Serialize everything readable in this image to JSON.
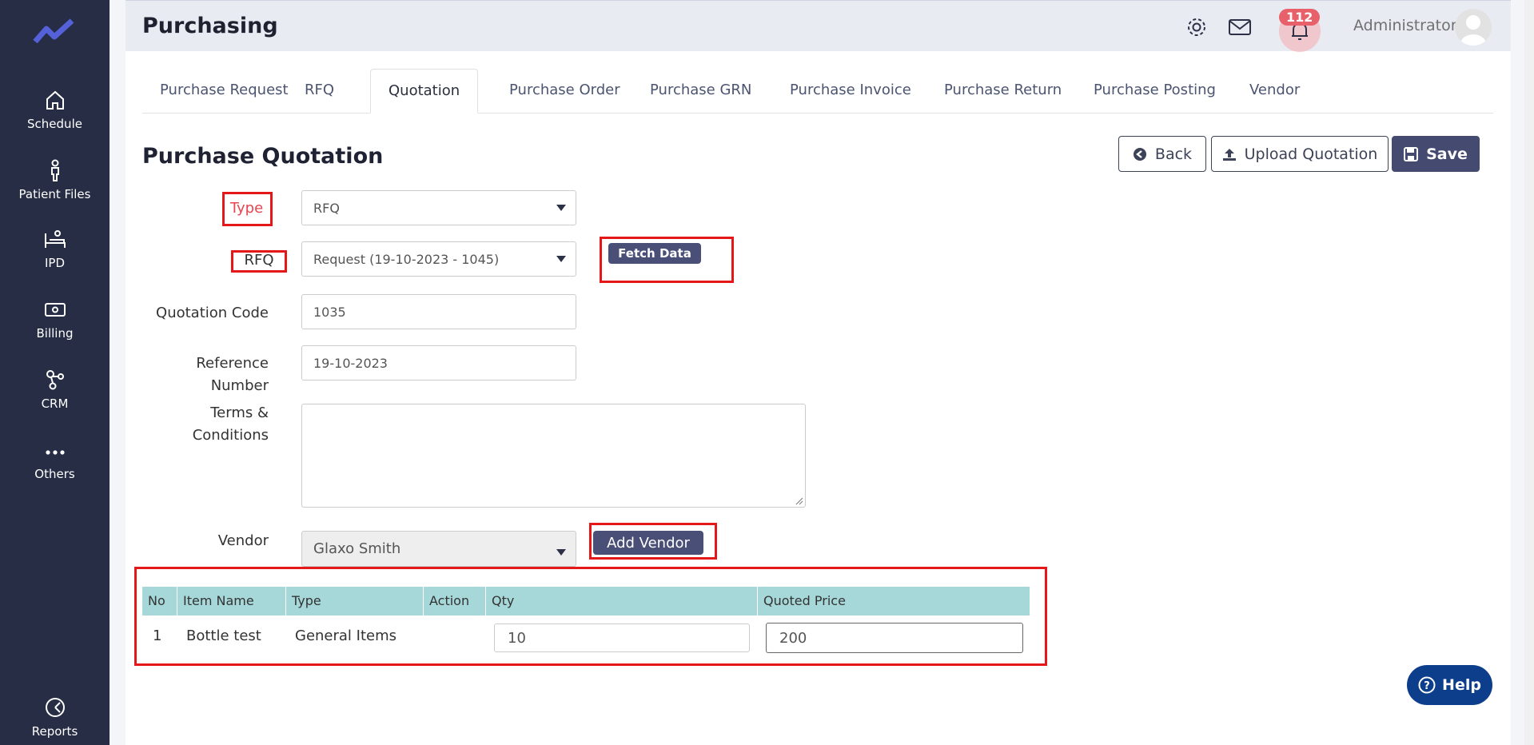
{
  "sidebar": {
    "items": [
      {
        "label": "Schedule",
        "icon": "home-icon"
      },
      {
        "label": "Patient Files",
        "icon": "person-icon"
      },
      {
        "label": "IPD",
        "icon": "bed-icon"
      },
      {
        "label": "Billing",
        "icon": "cash-icon"
      },
      {
        "label": "CRM",
        "icon": "network-icon"
      },
      {
        "label": "Others",
        "icon": "more-icon"
      },
      {
        "label": "Reports",
        "icon": "pie-icon"
      }
    ]
  },
  "header": {
    "title": "Purchasing",
    "notification_count": "112",
    "user": "Administrator"
  },
  "tabs": [
    "Purchase Request",
    "RFQ",
    "Quotation",
    "Purchase Order",
    "Purchase GRN",
    "Purchase Invoice",
    "Purchase Return",
    "Purchase Posting",
    "Vendor"
  ],
  "page": {
    "title": "Purchase Quotation",
    "back_label": "Back",
    "upload_label": "Upload Quotation",
    "save_label": "Save"
  },
  "form": {
    "type_label": "Type",
    "type_value": "RFQ",
    "rfq_label": "RFQ",
    "rfq_value": "Request (19-10-2023 - 1045)",
    "fetch_label": "Fetch Data",
    "code_label": "Quotation Code",
    "code_value": "1035",
    "ref_label_1": "Reference",
    "ref_label_2": "Number",
    "ref_value": "19-10-2023",
    "terms_label_1": "Terms &",
    "terms_label_2": "Conditions",
    "vendor_label": "Vendor",
    "vendor_value": "Glaxo Smith",
    "add_vendor_label": "Add Vendor"
  },
  "table": {
    "headers": [
      "No",
      "Item Name",
      "Type",
      "Action",
      "Qty",
      "Quoted Price"
    ],
    "rows": [
      {
        "no": "1",
        "item": "Bottle test",
        "type": "General Items",
        "qty": "10",
        "price": "200"
      }
    ]
  },
  "help_label": "Help",
  "colors": {
    "sidebar_bg": "#262d45",
    "primary": "#454b70",
    "table_header": "#a7d8d9",
    "highlight_red": "#e41818",
    "help_blue": "#0d3e8c",
    "badge": "#e8616a"
  }
}
